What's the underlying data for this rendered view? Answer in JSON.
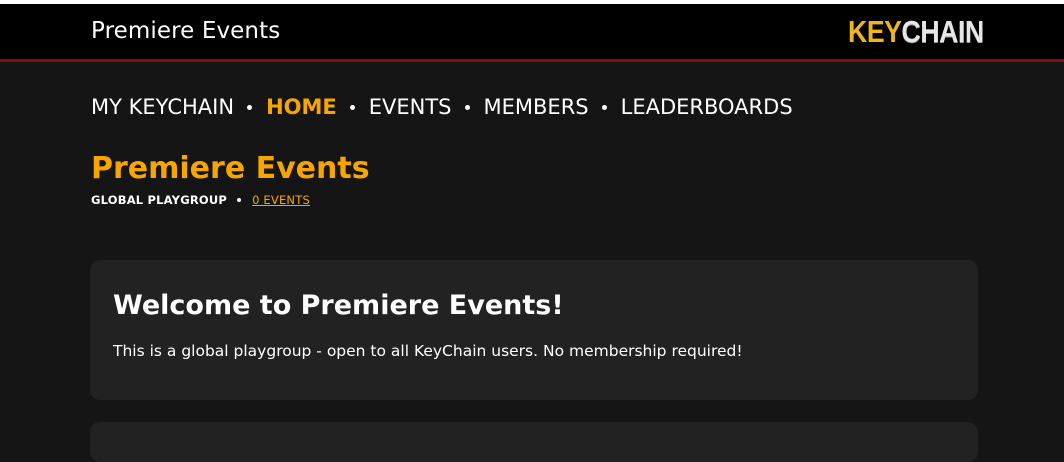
{
  "header": {
    "title": "Premiere Events",
    "logo_key": "KEY",
    "logo_chain": "CHAIN"
  },
  "nav": {
    "items": [
      {
        "label": "MY KEYCHAIN"
      },
      {
        "label": "HOME",
        "active": true
      },
      {
        "label": "EVENTS"
      },
      {
        "label": "MEMBERS"
      },
      {
        "label": "LEADERBOARDS"
      }
    ]
  },
  "page": {
    "title": "Premiere Events",
    "group_type": "GLOBAL PLAYGROUP",
    "events_link": "0 EVENTS"
  },
  "welcome_card": {
    "heading": "Welcome to Premiere Events!",
    "body": "This is a global playgroup - open to all KeyChain users. No membership required!"
  },
  "colors": {
    "accent": "#f7a600",
    "background": "#151515",
    "card": "#222222",
    "header": "#000000",
    "header_border": "#7a1010"
  }
}
